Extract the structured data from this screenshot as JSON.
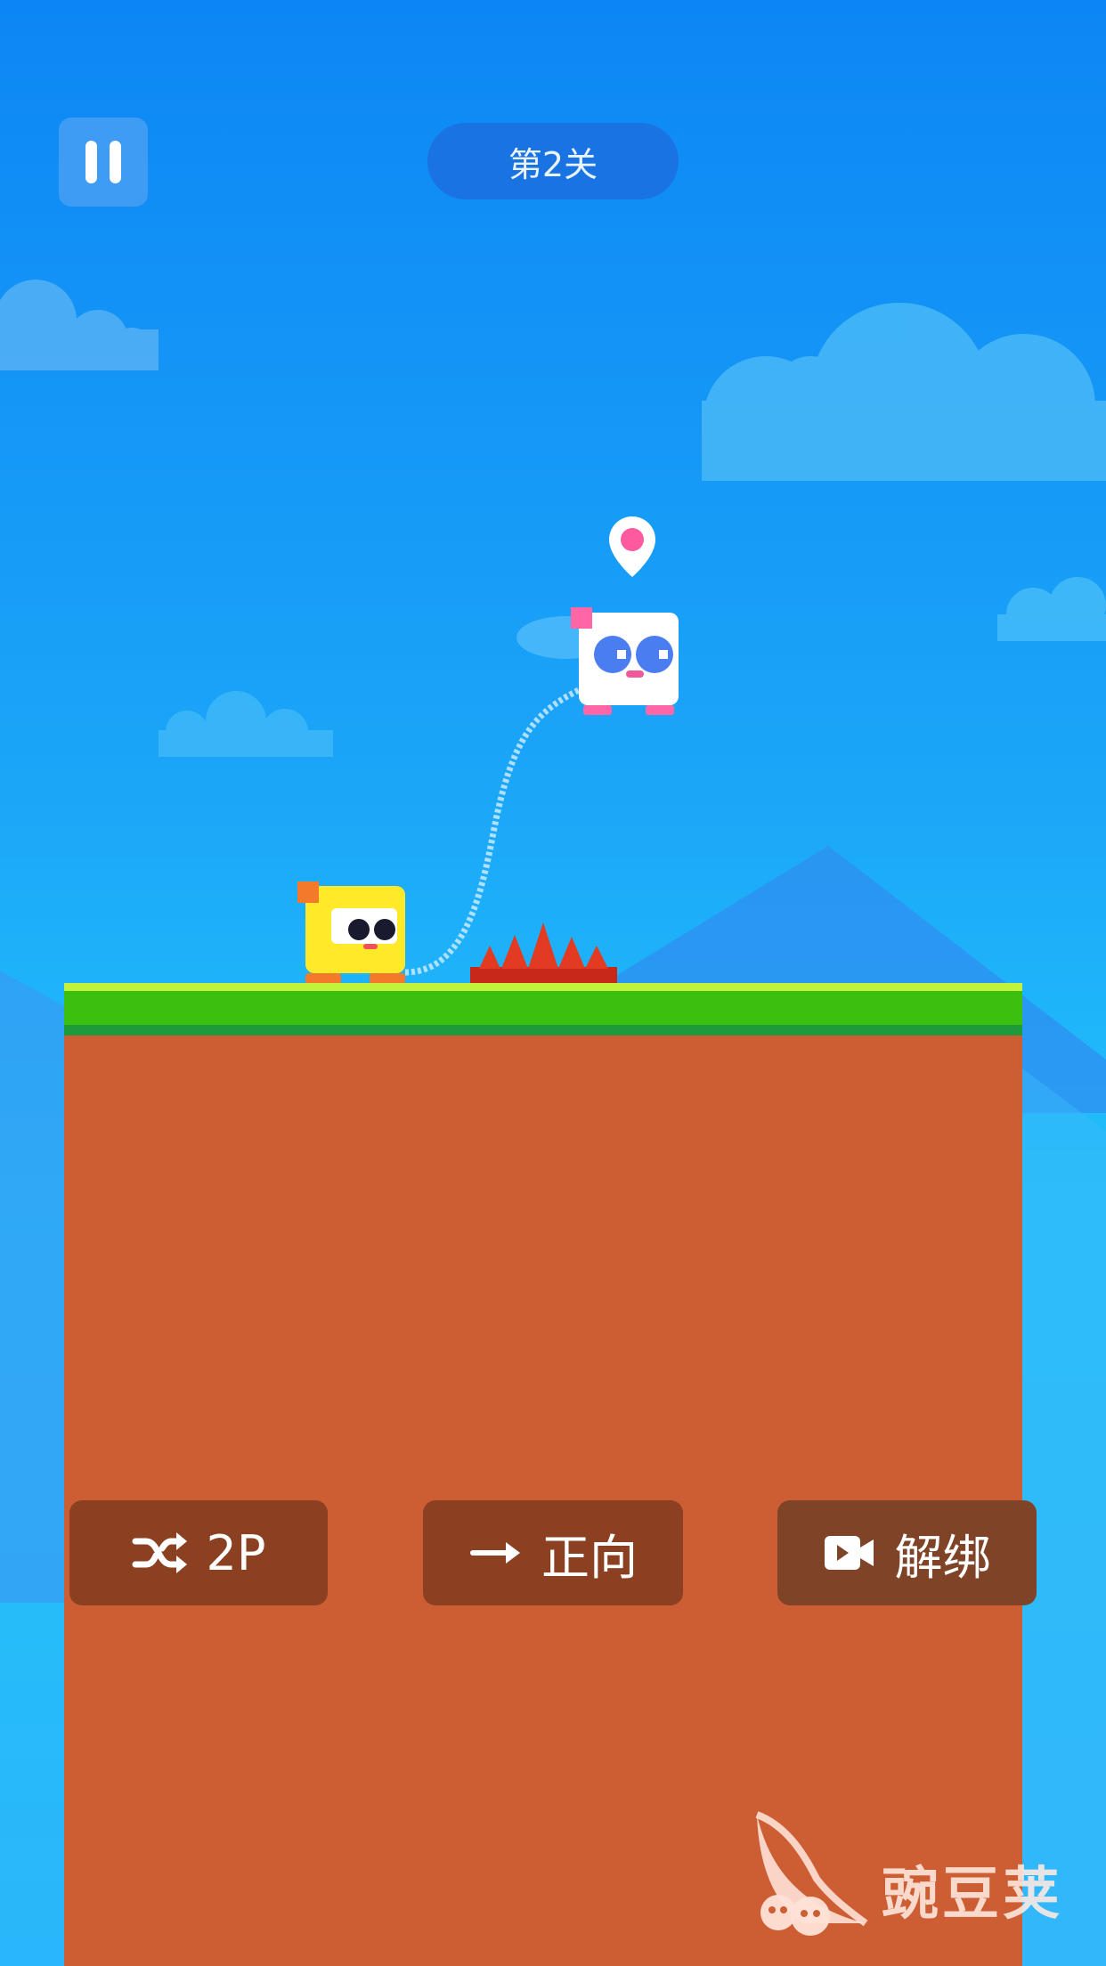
{
  "level": {
    "label": "第2关"
  },
  "controls": {
    "two_player": {
      "label": "2P",
      "icon": "shuffle-icon"
    },
    "direction": {
      "label": "正向",
      "icon": "arrow-right-icon"
    },
    "unbind": {
      "label": "解绑",
      "icon": "video-camera-icon"
    }
  },
  "watermark": {
    "text": "豌豆荚",
    "icon": "pea-pod-logo-icon"
  },
  "colors": {
    "sky_top": "#0d86f5",
    "sky_bottom": "#2ab6fa",
    "grass": "#3cbf0e",
    "dirt": "#cd5e33",
    "button": "#8c4022",
    "player_yellow": "#ffe928",
    "player_white": "#ffffff",
    "spikes": "#e0321e"
  }
}
